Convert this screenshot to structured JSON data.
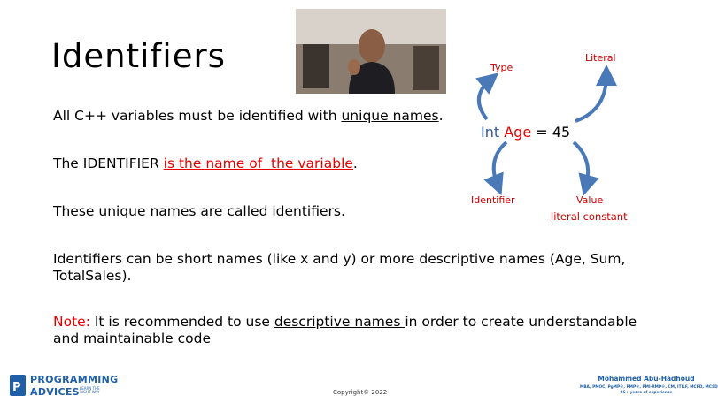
{
  "slide": {
    "title": "Identifiers",
    "line1": {
      "text": "All C++ variables must be identified with ",
      "underlined": "unique names",
      "end": "."
    },
    "line2": {
      "text": "The IDENTIFIER ",
      "highlight": "is the name of  the variable",
      "end": "."
    },
    "line3": "These unique names are called identifiers.",
    "line4": "Identifiers can be short names (like x and y) or more descriptive names (Age, Sum, TotalSales).",
    "note": {
      "label": "Note:",
      "text": " It is recommended to use ",
      "underlined": "descriptive names ",
      "end": "in order to create understandable and maintainable code"
    }
  },
  "diagram": {
    "type_label": "Type",
    "literal_label": "Literal",
    "identifier_label": "Identifier",
    "value_label": "Value",
    "literal_constant_label": "literal constant",
    "code": {
      "keyword": "Int",
      "identifier": "Age",
      "rest": " = 45"
    },
    "colors": {
      "arrow": "#4a79b8",
      "keyword": "#2f5597",
      "identifier": "#e60000",
      "label": "#cc0000"
    }
  },
  "footer": {
    "logo_line1": "PROGRAMMING",
    "logo_line2": "ADVICES",
    "logo_tag": "LEARN THE RIGHT WAY",
    "copyright": "Copyright© 2022",
    "author_name": "Mohammed Abu-Hadhoud",
    "author_creds": "MBA, PMOC, PgMP®, PMP®, PMI-RMP®, CM, ITILF, MCPD, MCSD",
    "author_experience": "26+ years of experience",
    "brand_color": "#1f5fa8"
  },
  "video": {
    "present": true
  }
}
